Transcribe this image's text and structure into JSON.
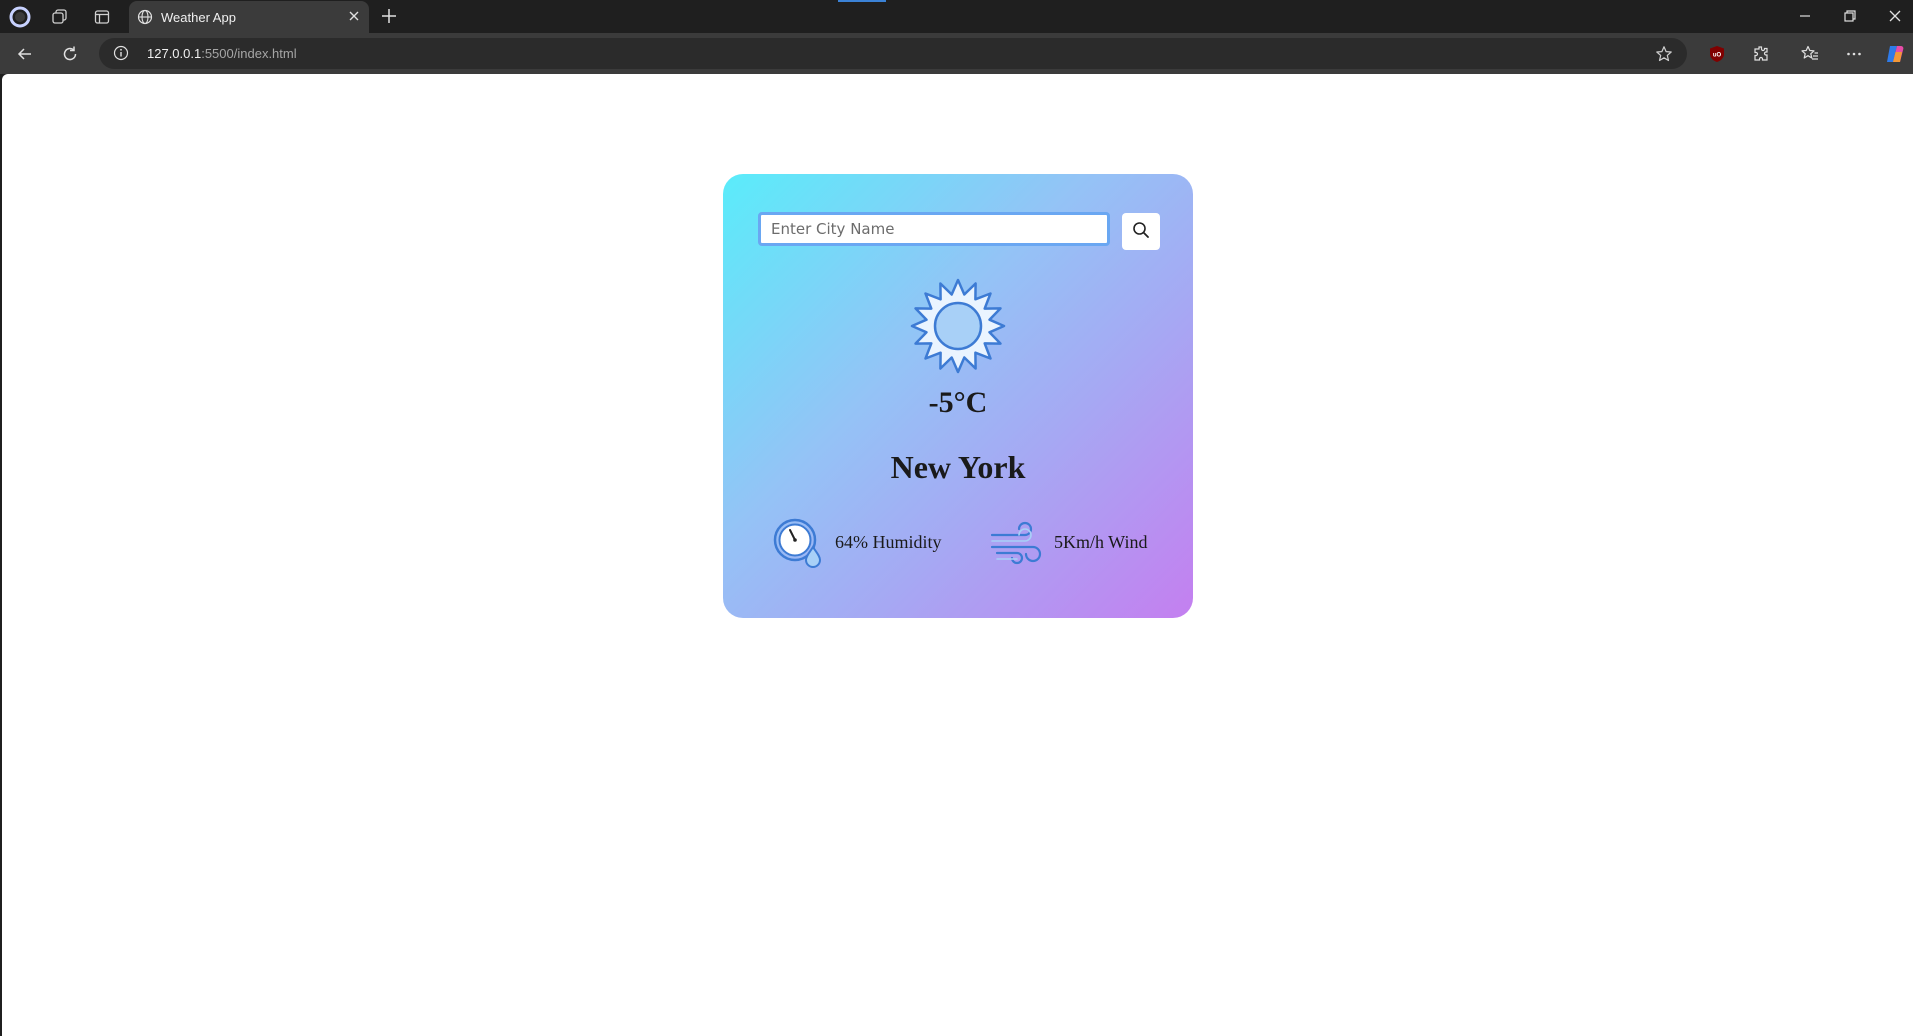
{
  "browser": {
    "tab_title": "Weather App",
    "address_host": "127.0.0.1",
    "address_rest": ":5500/index.html",
    "extension_badge": "uO"
  },
  "app": {
    "search_placeholder": "Enter City Name",
    "temperature": "-5°C",
    "city": "New York",
    "humidity_text": "64% Humidity",
    "wind_text": "5Km/h Wind",
    "weather_icon": "sun-icon",
    "colors": {
      "gradient_start": "#5aecfa",
      "gradient_end": "#c47ff0",
      "input_border": "#6aa7f2"
    }
  }
}
